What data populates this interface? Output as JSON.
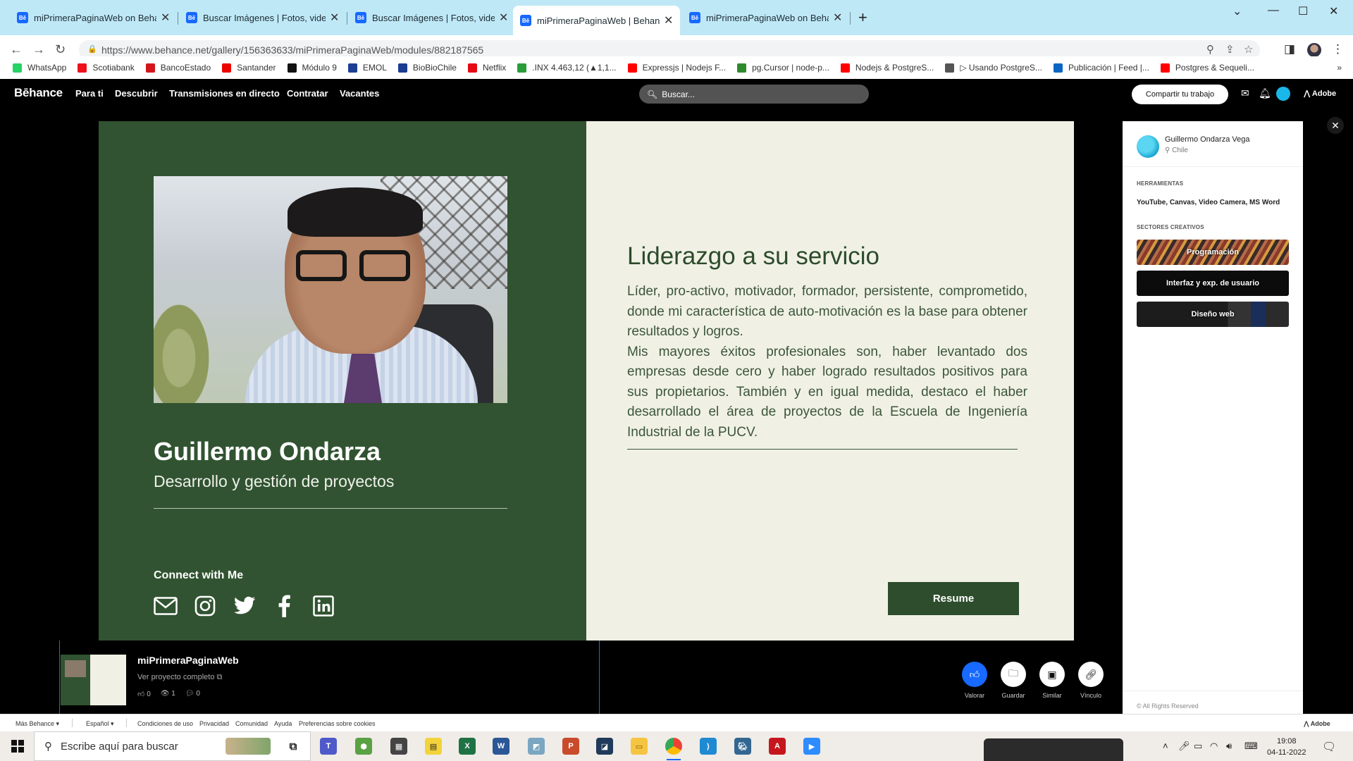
{
  "browser": {
    "tabs": [
      {
        "label": "miPrimeraPaginaWeb on Behance",
        "favicon": "Bē",
        "active": false
      },
      {
        "label": "Buscar Imágenes | Fotos, videos,",
        "favicon": "Bē",
        "active": false
      },
      {
        "label": "Buscar Imágenes | Fotos, videos,",
        "favicon": "Bē",
        "active": false
      },
      {
        "label": "miPrimeraPaginaWeb | Behance",
        "favicon": "Bē",
        "active": true
      },
      {
        "label": "miPrimeraPaginaWeb on Behance",
        "favicon": "Bē",
        "active": false
      }
    ],
    "url": "https://www.behance.net/gallery/156363633/miPrimeraPaginaWeb/modules/882187565",
    "bookmarks": [
      {
        "label": "WhatsApp",
        "icon": "whatsapp-icon",
        "color": "#25d366"
      },
      {
        "label": "Scotiabank",
        "icon": "scotiabank-icon",
        "color": "#ec111a"
      },
      {
        "label": "BancoEstado",
        "icon": "bancoestado-icon",
        "color": "#d4141c"
      },
      {
        "label": "Santander",
        "icon": "santander-icon",
        "color": "#ec0000"
      },
      {
        "label": "Módulo 9",
        "icon": "github-icon",
        "color": "#111111"
      },
      {
        "label": "EMOL",
        "icon": "emol-icon",
        "color": "#1c3f94"
      },
      {
        "label": "BioBioChile",
        "icon": "biobio-icon",
        "color": "#1a3d8f"
      },
      {
        "label": "Netflix",
        "icon": "netflix-icon",
        "color": "#e50914"
      },
      {
        "label": ".INX 4.463,12 (▲1,1...",
        "icon": "chart-icon",
        "color": "#2a9d3a"
      },
      {
        "label": "Expressjs | Nodejs F...",
        "icon": "youtube-icon",
        "color": "#ff0000"
      },
      {
        "label": "pg.Cursor | node-p...",
        "icon": "pg-icon",
        "color": "#2d8a2d"
      },
      {
        "label": "Nodejs & PostgreS...",
        "icon": "youtube-icon",
        "color": "#ff0000"
      },
      {
        "label": "▷ Usando PostgreS...",
        "icon": "link-icon",
        "color": "#555555"
      },
      {
        "label": "Publicación | Feed |...",
        "icon": "linkedin-icon",
        "color": "#0a66c2"
      },
      {
        "label": "Postgres & Sequeli...",
        "icon": "youtube-icon",
        "color": "#ff0000"
      }
    ]
  },
  "behance": {
    "logo": "Bēhance",
    "nav": [
      "Para ti",
      "Descubrir",
      "Transmisiones en directo",
      "Contratar",
      "Vacantes"
    ],
    "search_placeholder": "Buscar...",
    "share_label": "Compartir tu trabajo",
    "adobe_label": "Adobe"
  },
  "project": {
    "name": "Guillermo Ondarza",
    "role": "Desarrollo y gestión de proyectos",
    "connect_label": "Connect with Me",
    "social_icons": [
      "mail-icon",
      "instagram-icon",
      "twitter-icon",
      "facebook-icon",
      "linkedin-icon"
    ],
    "headline": "Liderazgo a su servicio",
    "body_p1": "Líder, pro-activo, motivador, formador, persistente, comprometido, donde mi característica de auto-motivación es la base para obtener resultados y logros.",
    "body_p2": "Mis mayores éxitos profesionales son, haber levantado dos empresas desde cero y haber logrado resultados positivos para sus propietarios. También y en igual medida, destaco el haber desarrollado el área de proyectos de la Escuela de Ingeniería Industrial de la PUCV.",
    "resume_label": "Resume",
    "colors": {
      "green": "#315331",
      "cream": "#f0f1e4"
    }
  },
  "panel": {
    "owner_name": "Guillermo Ondarza Vega",
    "owner_location": "Chile",
    "tools_heading": "HERRAMIENTAS",
    "tools": "YouTube, Canvas, Video Camera, MS Word",
    "sectors_heading": "SECTORES CREATIVOS",
    "sectors": [
      "Programación",
      "Interfaz y exp. de usuario",
      "Diseño web"
    ],
    "rights": "© All Rights Reserved"
  },
  "footer": {
    "title": "miPrimeraPaginaWeb",
    "view_full": "Ver proyecto completo",
    "likes": "0",
    "views": "1",
    "comments": "0",
    "actions": [
      {
        "label": "Valorar",
        "icon": "thumbs-up-icon"
      },
      {
        "label": "Guardar",
        "icon": "folder-icon"
      },
      {
        "label": "Similar",
        "icon": "image-icon"
      },
      {
        "label": "Vínculo",
        "icon": "link-icon"
      }
    ]
  },
  "bottom_bar": {
    "more": "Más Behance ▾",
    "lang": "Español ▾",
    "links": [
      "Condiciones de uso",
      "Privacidad",
      "Comunidad",
      "Ayuda",
      "Preferencias sobre cookies"
    ],
    "adobe": "Adobe"
  },
  "taskbar": {
    "search_placeholder": "Escribe aquí para buscar",
    "time": "19:08",
    "date": "04-11-2022"
  }
}
